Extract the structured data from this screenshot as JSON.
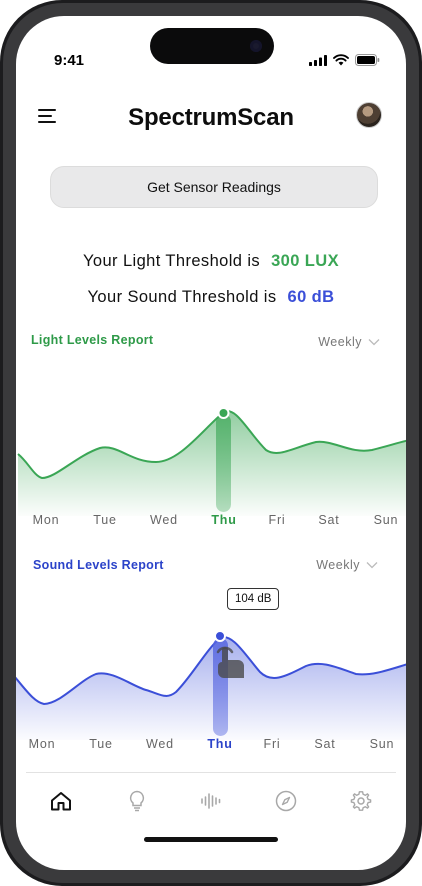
{
  "status_bar": {
    "time": "9:41"
  },
  "header": {
    "title": "SpectrumScan"
  },
  "actions": {
    "get_readings_label": "Get Sensor Readings"
  },
  "thresholds": {
    "light": {
      "prefix": "Your Light Threshold is",
      "value": "300 LUX"
    },
    "sound": {
      "prefix": "Your Sound Threshold is",
      "value": "60 dB"
    }
  },
  "light_report": {
    "title": "Light Levels Report",
    "period": "Weekly",
    "days": [
      "Mon",
      "Tue",
      "Wed",
      "Thu",
      "Fri",
      "Sat",
      "Sun"
    ],
    "active_day": "Thu"
  },
  "sound_report": {
    "title": "Sound Levels Report",
    "period": "Weekly",
    "days": [
      "Mon",
      "Tue",
      "Wed",
      "Thu",
      "Fri",
      "Sat",
      "Sun"
    ],
    "active_day": "Thu",
    "tooltip": "104 dB"
  },
  "tab_bar": {
    "items": [
      {
        "icon": "home-icon",
        "active": true
      },
      {
        "icon": "lightbulb-icon",
        "active": false
      },
      {
        "icon": "sound-wave-icon",
        "active": false
      },
      {
        "icon": "compass-icon",
        "active": false
      },
      {
        "icon": "gear-icon",
        "active": false
      }
    ]
  },
  "colors": {
    "light_accent": "#3aa655",
    "sound_accent": "#3b4fd8",
    "light_title": "#2e9a48",
    "sound_title": "#2b43c9"
  }
}
